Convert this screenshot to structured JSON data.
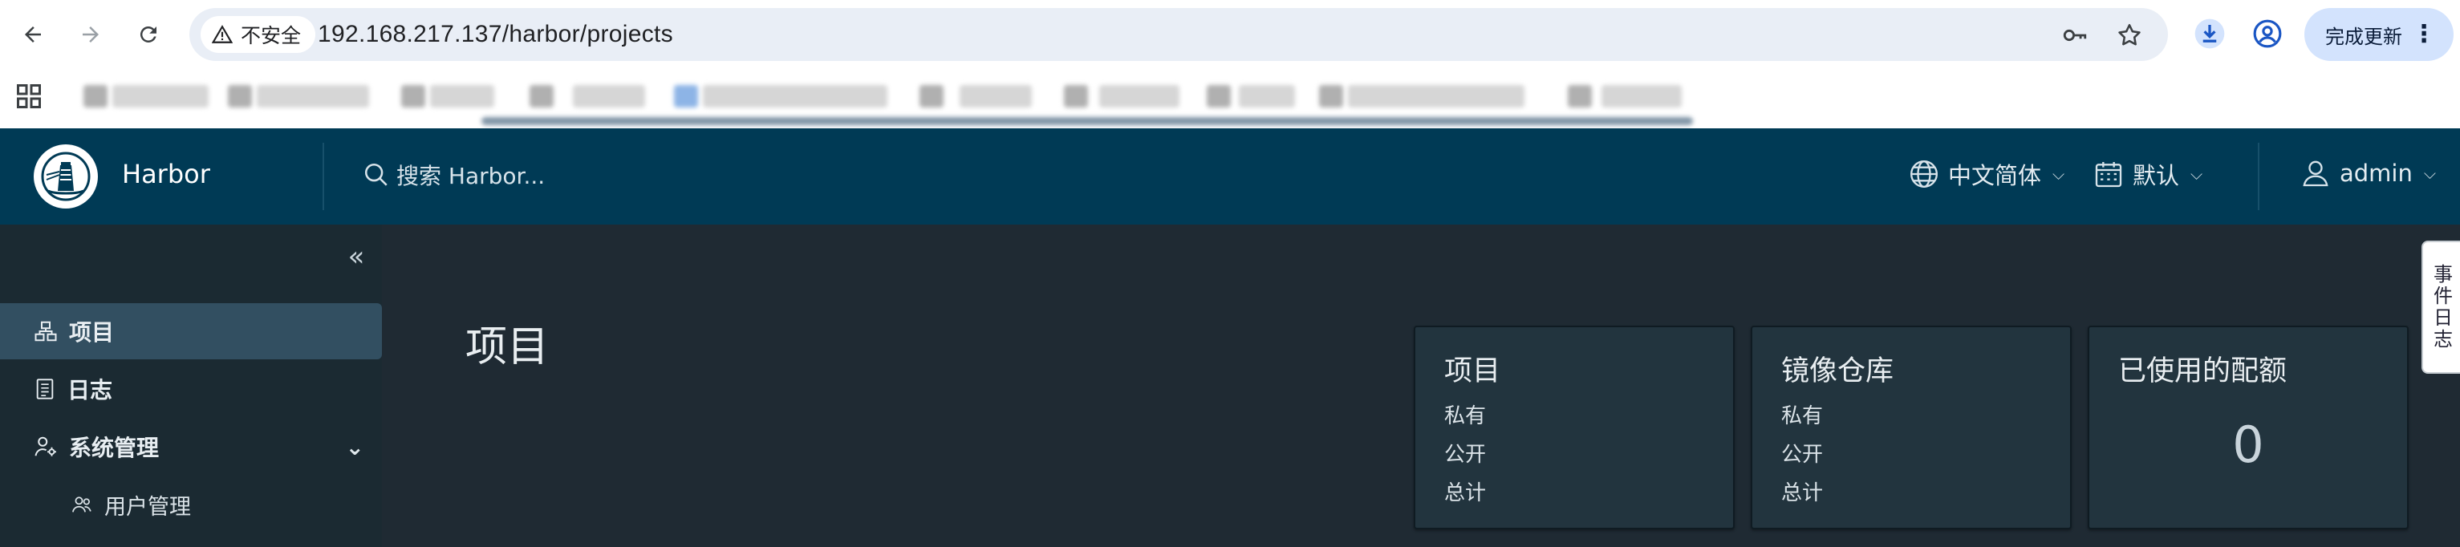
{
  "browser": {
    "security_label": "不安全",
    "url": "192.168.217.137/harbor/projects",
    "update_label": "完成更新"
  },
  "header": {
    "app_title": "Harbor",
    "search_placeholder": "搜索 Harbor...",
    "language": "中文简体",
    "datetime_format": "默认",
    "user": "admin"
  },
  "sidebar": {
    "items": [
      {
        "label": "项目"
      },
      {
        "label": "日志"
      },
      {
        "label": "系统管理"
      },
      {
        "label": "用户管理"
      }
    ]
  },
  "main": {
    "page_title": "项目",
    "cards": [
      {
        "title": "项目",
        "lines": [
          "私有",
          "公开",
          "总计"
        ]
      },
      {
        "title": "镜像仓库",
        "lines": [
          "私有",
          "公开",
          "总计"
        ]
      },
      {
        "title": "已使用的配额",
        "value": "0"
      }
    ],
    "event_log_tab": "事件日志"
  },
  "colors": {
    "header_bg": "#003a55",
    "sidebar_bg": "#1b2a32",
    "main_bg": "#1f2a33",
    "active_nav": "#324f61",
    "card_bg": "#22343e"
  }
}
